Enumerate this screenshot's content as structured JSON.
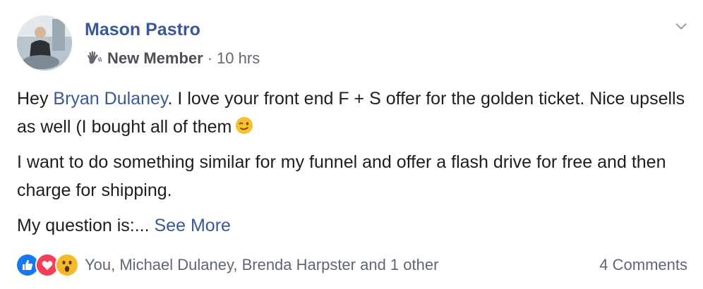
{
  "author": {
    "name": "Mason Pastro",
    "badge": "New Member",
    "separator": "·",
    "time": "10 hrs"
  },
  "post": {
    "line1_prefix": "Hey ",
    "mention": "Bryan Dulaney",
    "line1_rest": ". I love your front end F + S offer for the golden ticket. Nice upsells as well (I bought all of them",
    "paragraph2": "I want to do something similar for my funnel and offer a flash drive for free and then charge for shipping.",
    "paragraph3": "My question is:...",
    "see_more": "See More"
  },
  "footer": {
    "reaction_icons": [
      "like-icon",
      "love-icon",
      "wow-icon"
    ],
    "reaction_names": "You, Michael Dulaney, Brenda Harpster and 1 other",
    "comments": "4 Comments"
  },
  "colors": {
    "link": "#385898",
    "secondary_text": "#606770",
    "like": "#1877f2",
    "love": "#f33e58",
    "wow": "#f7b928"
  }
}
